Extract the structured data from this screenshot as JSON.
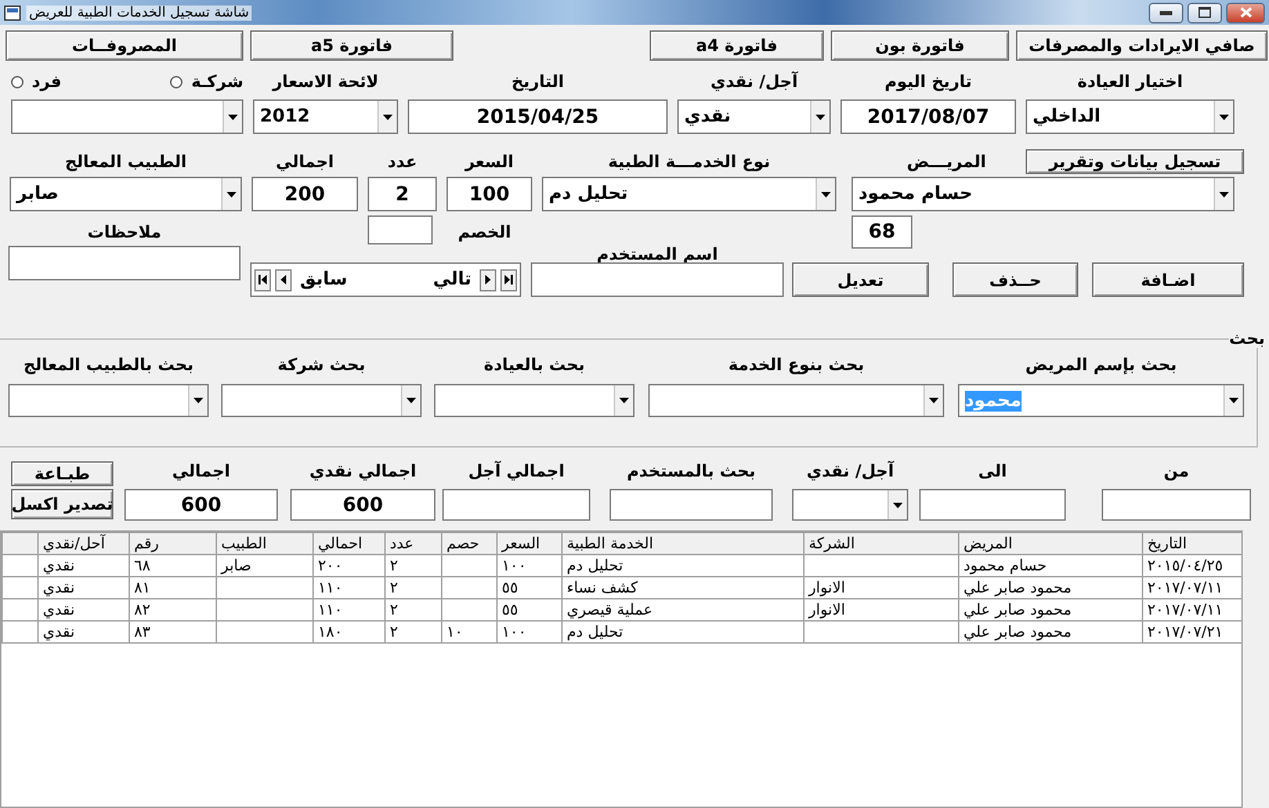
{
  "window": {
    "title": "شاشة تسجيل الخدمات الطبية للعريض"
  },
  "top_buttons": [
    "صافي الايرادات والمصرفات",
    "فاتورة بون",
    "فاتورة a4",
    "فاتورة a5",
    "المصروفــات"
  ],
  "form": {
    "row1": [
      {
        "label": "اختيار العيادة",
        "kind": "combo",
        "value": "الداخلي"
      },
      {
        "label": "تاريخ اليوم",
        "kind": "field",
        "value": "2017/08/07"
      },
      {
        "label": "آجل/ نقدي",
        "kind": "combo",
        "value": "نقدي"
      },
      {
        "label": "التاريخ",
        "kind": "field",
        "value": "2015/04/25"
      },
      {
        "label": "لائحة الاسعار",
        "kind": "combo",
        "value": "2012"
      },
      {
        "kind": "combo"
      }
    ],
    "customer_type": [
      {
        "label": "شركـة",
        "selected": false
      },
      {
        "label": "فرد",
        "selected": false
      }
    ],
    "report_button": "تسجيل بيانات وتقرير",
    "row2": [
      {
        "label": "المريـــض",
        "kind": "combo",
        "value": "حسام محمود"
      },
      {
        "label": "نوع الخدمـــة الطبية",
        "kind": "combo",
        "value": "تحليل دم"
      },
      {
        "label": "السعر",
        "kind": "field",
        "value": "100"
      },
      {
        "label": "عدد",
        "kind": "field",
        "value": "2"
      },
      {
        "label": "اجمالي",
        "kind": "field",
        "value": "200"
      },
      {
        "label": "الطبيب المعالج",
        "kind": "combo",
        "value": "صابر"
      }
    ],
    "record_number": "68",
    "discount": {
      "label": "الخصم"
    },
    "notes": {
      "label": "ملاحظات"
    },
    "action_buttons": [
      "اضـافة",
      "حــذف",
      "تعديل"
    ],
    "username": {
      "label": "اسم المستخدم"
    },
    "navigator": {
      "next": "تالي",
      "previous": "سابق"
    }
  },
  "search": {
    "title": "بحث",
    "fields": [
      {
        "label": "بحث بإسم المريض",
        "value": "محمود",
        "text_selected": true
      },
      {
        "label": "بحث بنوع الخدمة"
      },
      {
        "label": "بحث بالعيادة"
      },
      {
        "label": "بحث شركة"
      },
      {
        "label": "بحث بالطبيب المعالج"
      }
    ]
  },
  "totals": {
    "fields": [
      {
        "label": "من",
        "kind": "field"
      },
      {
        "label": "الى",
        "kind": "field"
      },
      {
        "label": "آجل/ نقدي",
        "kind": "combo"
      },
      {
        "label": "بحث بالمستخدم",
        "kind": "field"
      },
      {
        "label": "اجمالي آجل",
        "kind": "field"
      },
      {
        "label": "اجمالي نقدي",
        "kind": "field",
        "value": "600"
      },
      {
        "label": "اجمالي",
        "kind": "field",
        "value": "600"
      }
    ],
    "buttons": [
      "طبـاعة",
      "تصدير اكسل"
    ]
  },
  "table": {
    "columns": [
      "التاريخ",
      "المريض",
      "الشركة",
      "الخدمة الطبية",
      "السعر",
      "حصم",
      "عدد",
      "احمالي",
      "الطبيب",
      "رقم",
      "آحل/نقدي"
    ],
    "rows": [
      [
        "٢٠١٥/٠٤/٢٥",
        "حسام محمود",
        null,
        "تحليل دم",
        "١٠٠",
        null,
        "٢",
        "٢٠٠",
        "صابر",
        "٦٨",
        "نقدي"
      ],
      [
        "٢٠١٧/٠٧/١١",
        "محمود صابر علي",
        "الانوار",
        "كشف نساء",
        "٥٥",
        null,
        "٢",
        "١١٠",
        null,
        "٨١",
        "نقدي"
      ],
      [
        "٢٠١٧/٠٧/١١",
        "محمود صابر علي",
        "الانوار",
        "عملية قيصري",
        "٥٥",
        null,
        "٢",
        "١١٠",
        null,
        "٨٢",
        "نقدي"
      ],
      [
        "٢٠١٧/٠٧/٢١",
        "محمود صابر علي",
        null,
        "تحليل دم",
        "١٠٠",
        "١٠",
        "٢",
        "١٨٠",
        null,
        "٨٣",
        "نقدي"
      ]
    ]
  }
}
